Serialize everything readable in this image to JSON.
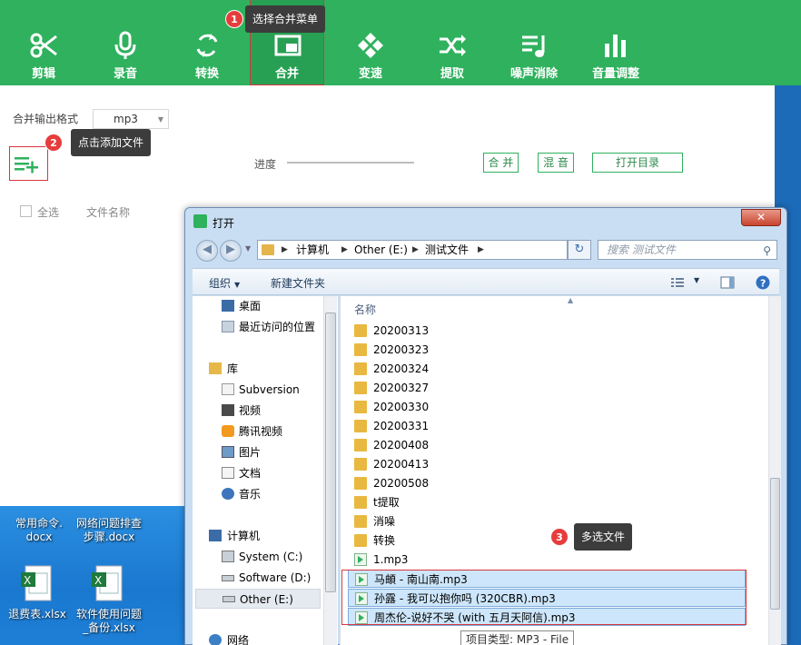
{
  "colors": {
    "accent": "#2fb15e",
    "callout_bg": "#3c3c3c",
    "highlight": "#d9363e"
  },
  "toolbar": {
    "items": [
      {
        "label": "剪辑",
        "icon": "scissors-icon"
      },
      {
        "label": "录音",
        "icon": "microphone-icon"
      },
      {
        "label": "转换",
        "icon": "convert-icon"
      },
      {
        "label": "合并",
        "icon": "merge-icon",
        "active": true
      },
      {
        "label": "变速",
        "icon": "speed-icon"
      },
      {
        "label": "提取",
        "icon": "extract-icon"
      },
      {
        "label": "噪声消除",
        "icon": "noise-icon"
      },
      {
        "label": "音量调整",
        "icon": "volume-icon"
      }
    ]
  },
  "callouts": [
    {
      "num": "1",
      "text": "选择合并菜单"
    },
    {
      "num": "2",
      "text": "点击添加文件"
    },
    {
      "num": "3",
      "text": "多选文件"
    }
  ],
  "merge": {
    "format_label": "合并输出格式",
    "format_value": "mp3",
    "progress_label": "进度",
    "merge_btn": "合 并",
    "mix_btn": "混 音",
    "open_dir_btn": "打开目录"
  },
  "list": {
    "select_all": "全选",
    "file_name": "文件名称"
  },
  "desktop": {
    "icons": [
      {
        "label": "常用命令.\ndocx"
      },
      {
        "label": "网络问题排查\n步骤.docx"
      },
      {
        "label": "退费表.xlsx"
      },
      {
        "label": "软件使用问题\n_备份.xlsx"
      }
    ]
  },
  "dialog": {
    "title": "打开",
    "close": "✕",
    "path": [
      "计算机",
      "Other (E:)",
      "测试文件"
    ],
    "search_placeholder": "搜索 测试文件",
    "organize": "组织",
    "new_folder": "新建文件夹",
    "nav": [
      {
        "label": "桌面",
        "icon": "desktop-icon"
      },
      {
        "label": "最近访问的位置",
        "icon": "recent-icon"
      },
      {
        "label": "库",
        "icon": "library-icon"
      },
      {
        "label": "Subversion",
        "icon": "library-folder-icon"
      },
      {
        "label": "视频",
        "icon": "video-icon"
      },
      {
        "label": "腾讯视频",
        "icon": "tencent-video-icon"
      },
      {
        "label": "图片",
        "icon": "pictures-icon"
      },
      {
        "label": "文档",
        "icon": "documents-icon"
      },
      {
        "label": "音乐",
        "icon": "music-icon"
      },
      {
        "label": "计算机",
        "icon": "computer-icon"
      },
      {
        "label": "System (C:)",
        "icon": "drive-icon"
      },
      {
        "label": "Software (D:)",
        "icon": "drive-icon"
      },
      {
        "label": "Other (E:)",
        "icon": "drive-icon",
        "selected": true
      },
      {
        "label": "网络",
        "icon": "network-icon"
      }
    ],
    "column_name": "名称",
    "files": [
      {
        "name": "20200313",
        "type": "folder"
      },
      {
        "name": "20200323",
        "type": "folder"
      },
      {
        "name": "20200324",
        "type": "folder"
      },
      {
        "name": "20200327",
        "type": "folder"
      },
      {
        "name": "20200330",
        "type": "folder"
      },
      {
        "name": "20200331",
        "type": "folder"
      },
      {
        "name": "20200408",
        "type": "folder"
      },
      {
        "name": "20200413",
        "type": "folder"
      },
      {
        "name": "20200508",
        "type": "folder"
      },
      {
        "name": "t提取",
        "type": "folder"
      },
      {
        "name": "消噪",
        "type": "folder"
      },
      {
        "name": "转换",
        "type": "folder"
      },
      {
        "name": "1.mp3",
        "type": "mp3"
      },
      {
        "name": "马頔 - 南山南.mp3",
        "type": "mp3",
        "selected": true
      },
      {
        "name": "孙露 - 我可以抱你吗 (320CBR).mp3",
        "type": "mp3",
        "selected": true
      },
      {
        "name": "周杰伦-说好不哭 (with 五月天阿信).mp3",
        "type": "mp3",
        "selected": true
      }
    ],
    "tooltip": "项目类型: MP3 - File"
  }
}
